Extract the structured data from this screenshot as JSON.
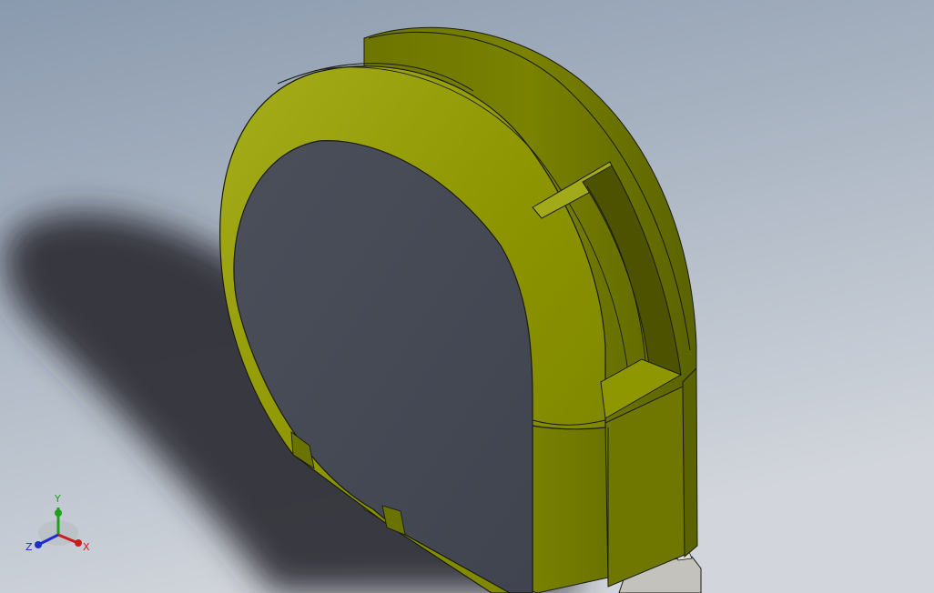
{
  "viewport": {
    "background_top": "#8a9aae",
    "background_bottom": "#d2d6dc",
    "shadow_color": "#2a2e33"
  },
  "model": {
    "body_color": "#808a00",
    "body_highlight": "#a0a818",
    "body_dark": "#5e6600",
    "face_color": "#454a55",
    "blade_color": "#c4c2bc",
    "edge_color": "#1a1c10"
  },
  "triad": {
    "x_label": "X",
    "y_label": "Y",
    "z_label": "Z",
    "x_color": "#c81e1e",
    "y_color": "#1ea01e",
    "z_color": "#1e2ec8"
  }
}
